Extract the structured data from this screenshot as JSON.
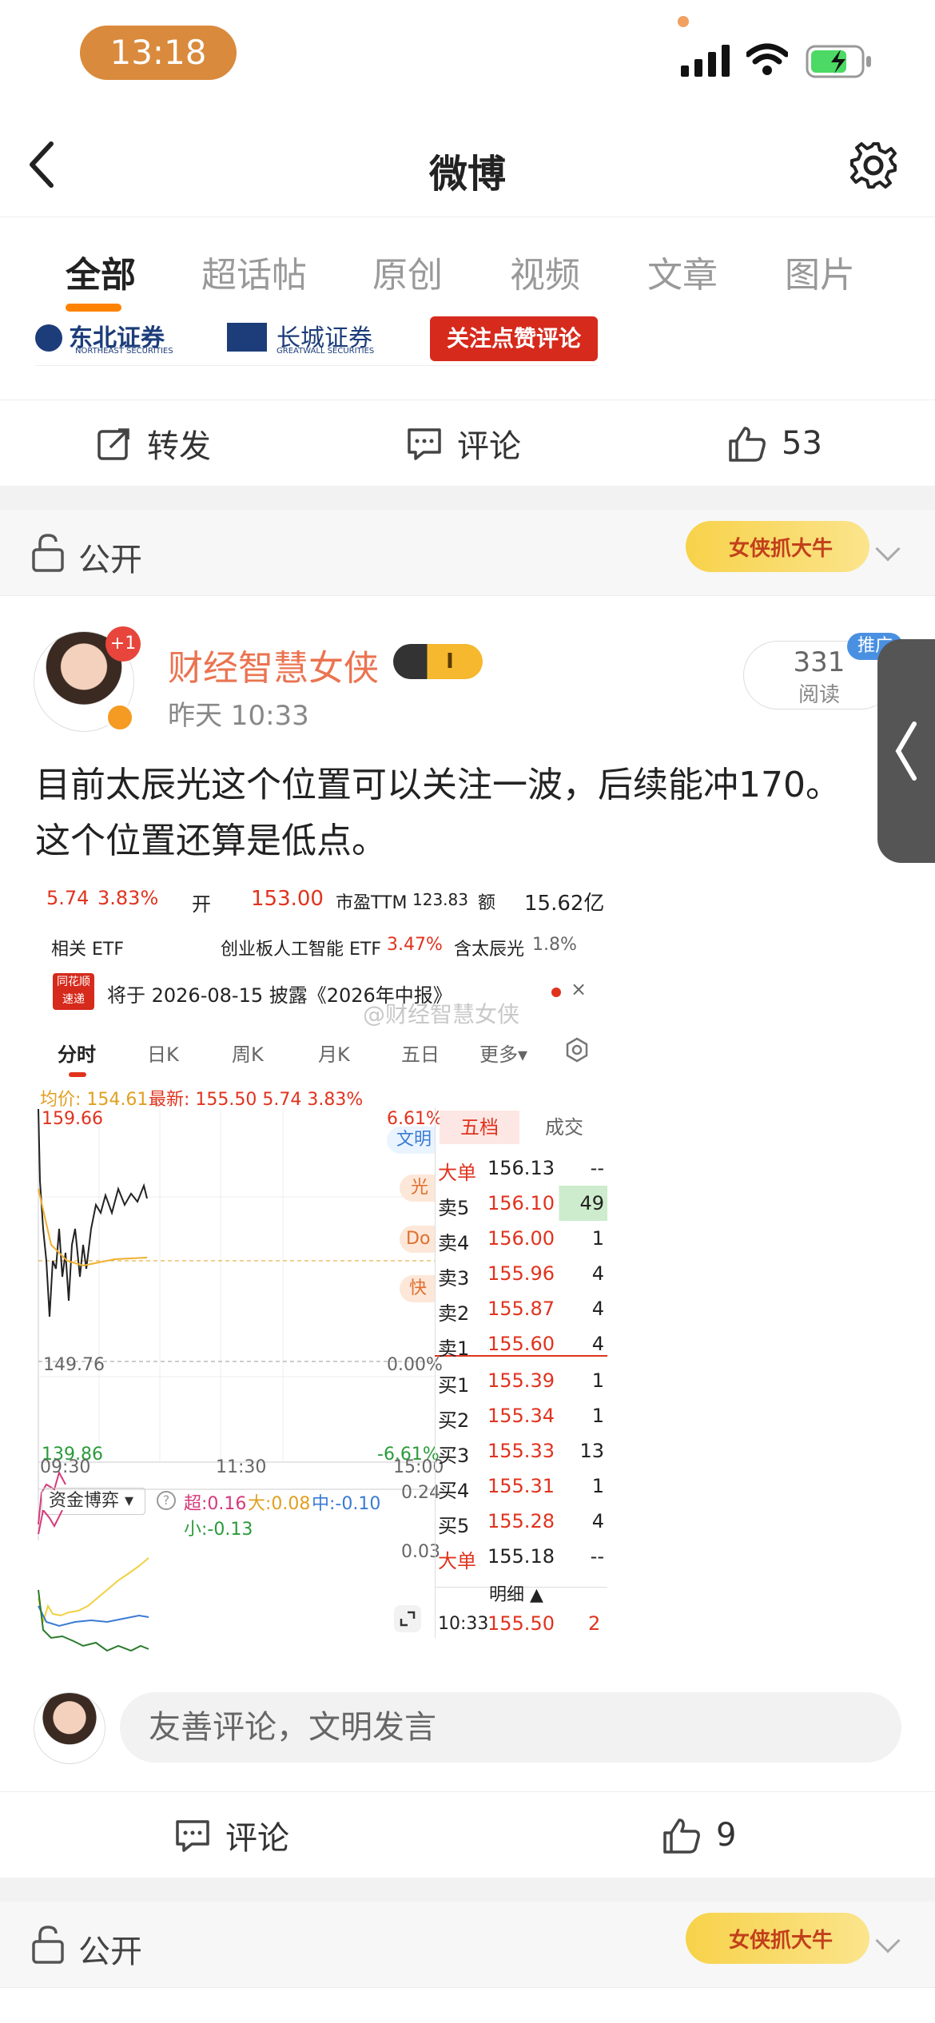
{
  "status_bar": {
    "time": "13:18"
  },
  "nav": {
    "title": "微博"
  },
  "tabs": [
    "全部",
    "超话帖",
    "原创",
    "视频",
    "文章",
    "图片"
  ],
  "prev_post": {
    "banner": {
      "brand1": "东北证券",
      "brand1_en": "NORTHEAST SECURITIES",
      "brand2": "长城证券",
      "brand2_en": "GREATWALL SECURITIES",
      "sticker": "关注点赞评论"
    },
    "actions": {
      "repost": "转发",
      "comment": "评论",
      "likes": "53"
    }
  },
  "visibility_label": "公开",
  "badge_text": "女侠抓大牛",
  "post": {
    "author": "财经智慧女侠",
    "avatar_badge": "+1",
    "level_badge": "I",
    "time": "昨天 10:33",
    "reads": "331",
    "reads_label": "阅读",
    "promo": "推广",
    "text_line1": "目前太辰光这个位置可以关注一波，后续能冲170。",
    "text_line2": "这个位置还算是低点。"
  },
  "screenshot": {
    "row1": {
      "chg": "5.74",
      "pct": "3.83%",
      "open_label": "开",
      "open": "153.00",
      "pe_label": "市盈TTM",
      "pe": "123.83",
      "amt_label": "额",
      "amt": "15.62亿"
    },
    "etf": {
      "label": "相关 ETF",
      "name": "创业板人工智能 ETF",
      "pct": "3.47%",
      "holding_label": "含太辰光",
      "holding": "1.8%"
    },
    "notice": {
      "logo1": "同花顺",
      "logo2": "速递",
      "text": "将于 2026-08-15 披露《2026年中报》"
    },
    "watermark": "@财经智慧女侠",
    "chart_tabs": [
      "分时",
      "日K",
      "周K",
      "月K",
      "五日",
      "更多▾"
    ],
    "avg_label": "均价: 154.61",
    "latest": "最新: 155.50  5.74  3.83%",
    "price_high": "159.66",
    "price_mid": "149.76",
    "price_low": "139.86",
    "pct_high": "6.61%",
    "pct_mid": "0.00%",
    "pct_low": "-6.61%",
    "times": [
      "09:30",
      "11:30",
      "15:00"
    ],
    "side_tags": [
      "文明",
      "光",
      "Do",
      "快"
    ],
    "flow": {
      "label": "资金博弈",
      "super": "超:0.16",
      "big": "大:0.08",
      "mid": "中:-0.10",
      "small": "小:-0.13",
      "top": "0.24",
      "mid_val": "0.03"
    },
    "orderbook": {
      "tabs": [
        "五档",
        "成交"
      ],
      "big_sell": {
        "label": "大单",
        "price": "156.13",
        "vol": "--"
      },
      "sells": [
        {
          "label": "卖5",
          "price": "156.10",
          "vol": "49"
        },
        {
          "label": "卖4",
          "price": "156.00",
          "vol": "1"
        },
        {
          "label": "卖3",
          "price": "155.96",
          "vol": "4"
        },
        {
          "label": "卖2",
          "price": "155.87",
          "vol": "4"
        },
        {
          "label": "卖1",
          "price": "155.60",
          "vol": "4"
        }
      ],
      "buys": [
        {
          "label": "买1",
          "price": "155.39",
          "vol": "1"
        },
        {
          "label": "买2",
          "price": "155.34",
          "vol": "1"
        },
        {
          "label": "买3",
          "price": "155.33",
          "vol": "13"
        },
        {
          "label": "买4",
          "price": "155.31",
          "vol": "1"
        },
        {
          "label": "买5",
          "price": "155.28",
          "vol": "4"
        }
      ],
      "big_buy": {
        "label": "大单",
        "price": "155.18",
        "vol": "--"
      },
      "detail_label": "明细 ▲",
      "last_trade": {
        "time": "10:33",
        "price": "155.50",
        "vol": "2"
      }
    }
  },
  "comment_placeholder": "友善评论，文明发言",
  "post_actions": {
    "comment": "评论",
    "likes": "9"
  },
  "colors": {
    "accent": "#ff8200",
    "red": "#e0331e",
    "green": "#2a9b3a",
    "username": "#eb7350"
  }
}
